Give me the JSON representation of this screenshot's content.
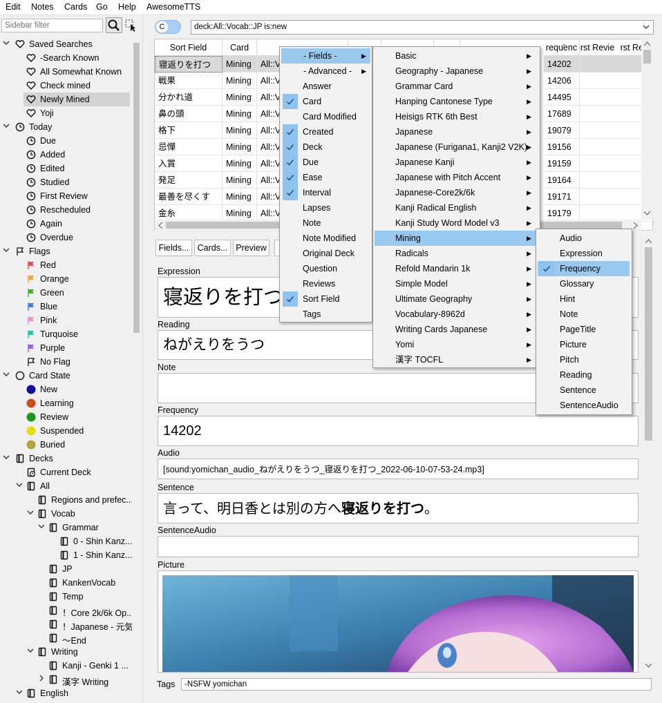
{
  "menubar": [
    "Edit",
    "Notes",
    "Cards",
    "Go",
    "Help",
    "AwesomeTTS"
  ],
  "sidebar": {
    "filter_placeholder": "Sidebar filter",
    "items": [
      {
        "label": "Saved Searches"
      },
      {
        "label": "-Search Known"
      },
      {
        "label": "All Somewhat Known"
      },
      {
        "label": "Check mined"
      },
      {
        "label": "Newly Mined"
      },
      {
        "label": "Yoji"
      },
      {
        "label": "Today"
      },
      {
        "label": "Due"
      },
      {
        "label": "Added"
      },
      {
        "label": "Edited"
      },
      {
        "label": "Studied"
      },
      {
        "label": "First Review"
      },
      {
        "label": "Rescheduled"
      },
      {
        "label": "Again"
      },
      {
        "label": "Overdue"
      },
      {
        "label": "Flags"
      },
      {
        "label": "Red"
      },
      {
        "label": "Orange"
      },
      {
        "label": "Green"
      },
      {
        "label": "Blue"
      },
      {
        "label": "Pink"
      },
      {
        "label": "Turquoise"
      },
      {
        "label": "Purple"
      },
      {
        "label": "No Flag"
      },
      {
        "label": "Card State"
      },
      {
        "label": "New"
      },
      {
        "label": "Learning"
      },
      {
        "label": "Review"
      },
      {
        "label": "Suspended"
      },
      {
        "label": "Buried"
      },
      {
        "label": "Decks"
      },
      {
        "label": "Current Deck"
      },
      {
        "label": "All"
      },
      {
        "label": "Regions and prefec..."
      },
      {
        "label": "Vocab"
      },
      {
        "label": "Grammar"
      },
      {
        "label": "0 - Shin Kanz..."
      },
      {
        "label": "1 - Shin Kanz..."
      },
      {
        "label": "JP"
      },
      {
        "label": "KankenVocab"
      },
      {
        "label": "Temp"
      },
      {
        "label": "！Core 2k/6k Op..."
      },
      {
        "label": "！Japanese - 元気"
      },
      {
        "label": "～End"
      },
      {
        "label": "Writing"
      },
      {
        "label": "Kanji - Genki 1 ..."
      },
      {
        "label": "漢字 Writing"
      },
      {
        "label": "English"
      }
    ],
    "flag_colors": {
      "Red": "#e5504a",
      "Orange": "#f7a13a",
      "Green": "#4caf27",
      "Blue": "#3d7ee8",
      "Pink": "#f48bd4",
      "Turquoise": "#20c6a8",
      "Purple": "#9b5ce6"
    },
    "state_colors": {
      "New": "#10109a",
      "Learning": "#c8501e",
      "Review": "#1a9a1a",
      "Suspended": "#e0e010",
      "Buried": "#b0a53a"
    }
  },
  "search": {
    "toggle": "C",
    "query": "deck:All::Vocab::JP is:new"
  },
  "table": {
    "headers": [
      "Sort Field",
      "Card",
      "",
      "",
      "",
      "",
      "requenc",
      "rst Revie",
      "rst Rev"
    ],
    "rows": [
      [
        "寝返りを打つ",
        "Mining",
        "All::Vo",
        "14202"
      ],
      [
        "戦果",
        "Mining",
        "All::Vo",
        "14206"
      ],
      [
        "分かれ道",
        "Mining",
        "All::Vo",
        "14495"
      ],
      [
        "鼻の頭",
        "Mining",
        "All::Vo",
        "17689"
      ],
      [
        "格下",
        "Mining",
        "All::Vo",
        "19079"
      ],
      [
        "忌憚",
        "Mining",
        "All::Vo",
        "19156"
      ],
      [
        "入賞",
        "Mining",
        "All::Vo",
        "19159"
      ],
      [
        "発足",
        "Mining",
        "All::Vo",
        "19164"
      ],
      [
        "最善を尽くす",
        "Mining",
        "All::Vo",
        "19171"
      ],
      [
        "金糸",
        "Mining",
        "All::Vo",
        "19179"
      ]
    ]
  },
  "editor": {
    "buttons": [
      "Fields...",
      "Cards...",
      "Preview"
    ],
    "fields": [
      {
        "name": "Expression",
        "value": "寝返りを打つ"
      },
      {
        "name": "Reading",
        "value": "ねがえりをうつ"
      },
      {
        "name": "Note",
        "value": ""
      },
      {
        "name": "Frequency",
        "value": "14202"
      },
      {
        "name": "Audio",
        "value": "[sound:yomichan_audio_ねがえりをうつ_寝返りを打つ_2022-06-10-07-53-24.mp3]"
      },
      {
        "name": "Sentence",
        "value_pre": "言って、明日香とは別の方へ",
        "value_bold": "寝返りを打つ",
        "value_post": "。"
      },
      {
        "name": "SentenceAudio",
        "value": ""
      },
      {
        "name": "Picture",
        "value": ""
      }
    ],
    "tags_label": "Tags",
    "tags_value": "-NSFW yomichan"
  },
  "menu1": {
    "items": [
      {
        "label": "- Fields -",
        "sub": true,
        "hl": true
      },
      {
        "label": "- Advanced -",
        "sub": true
      },
      {
        "label": "Answer"
      },
      {
        "label": "Card",
        "checked": true
      },
      {
        "label": "Card Modified"
      },
      {
        "label": "Created",
        "checked": true
      },
      {
        "label": "Deck",
        "checked": true
      },
      {
        "label": "Due",
        "checked": true
      },
      {
        "label": "Ease",
        "checked": true
      },
      {
        "label": "Interval",
        "checked": true
      },
      {
        "label": "Lapses"
      },
      {
        "label": "Note"
      },
      {
        "label": "Note Modified"
      },
      {
        "label": "Original Deck"
      },
      {
        "label": "Question"
      },
      {
        "label": "Reviews"
      },
      {
        "label": "Sort Field",
        "checked": true
      },
      {
        "label": "Tags"
      }
    ]
  },
  "menu2": {
    "items": [
      "Basic",
      "Geography - Japanese",
      "Grammar Card",
      "Hanping Cantonese Type",
      "Heisigs RTK 6th Best",
      "Japanese",
      "Japanese (Furigana1, Kanji2 V2K)",
      "Japanese Kanji",
      "Japanese with Pitch Accent",
      "Japanese-Core2k/6k",
      "Kanji Radical English",
      "Kanji Study Word Model v3",
      "Mining",
      "Radicals",
      "Refold Mandarin 1k",
      "Simple Model",
      "Ultimate Geography",
      "Vocabulary-8962d",
      "Writing Cards Japanese",
      "Yomi",
      "漢字 TOCFL"
    ],
    "highlighted": "Mining"
  },
  "menu3": {
    "items": [
      "Audio",
      "Expression",
      "Frequency",
      "Glossary",
      "Hint",
      "Note",
      "PageTitle",
      "Picture",
      "Pitch",
      "Reading",
      "Sentence",
      "SentenceAudio"
    ],
    "checked": "Frequency"
  }
}
